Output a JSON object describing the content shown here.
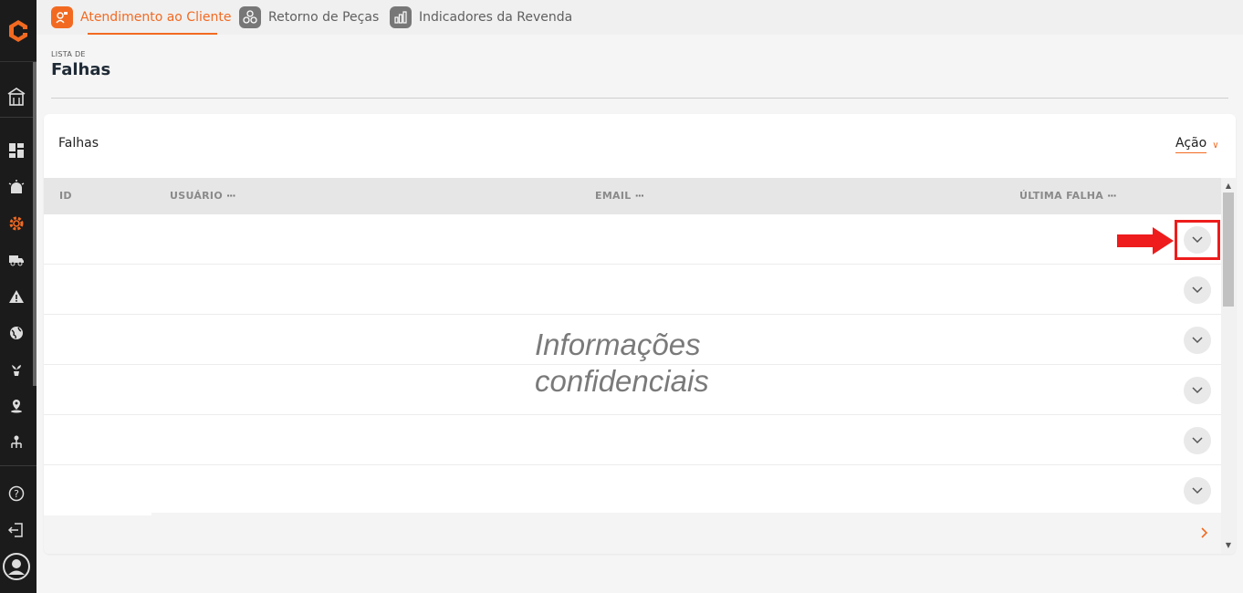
{
  "topbar": {
    "tabs": [
      {
        "label": "Atendimento ao Cliente",
        "icon": "customer-service-icon",
        "active": true
      },
      {
        "label": "Retorno de Peças",
        "icon": "parts-return-icon",
        "active": false
      },
      {
        "label": "Indicadores da Revenda",
        "icon": "bar-chart-icon",
        "active": false
      }
    ]
  },
  "sidebar": {
    "items": [
      "company-icon",
      "dashboard-icon",
      "alarm-icon",
      "settings-gear-icon",
      "truck-icon",
      "warning-icon",
      "globe-icon",
      "plant-icon",
      "location-icon",
      "hierarchy-icon",
      "help-icon",
      "logout-icon",
      "user-avatar-icon"
    ]
  },
  "page": {
    "label": "LISTA DE",
    "title": "Falhas"
  },
  "card": {
    "title": "Falhas",
    "action_label": "Ação"
  },
  "table": {
    "columns": [
      {
        "label": "ID",
        "menu": ""
      },
      {
        "label": "USUÁRIO",
        "menu": "···"
      },
      {
        "label": "EMAIL",
        "menu": "···"
      },
      {
        "label": "ÚLTIMA FALHA",
        "menu": "···"
      }
    ],
    "row_count": 6
  },
  "overlay": {
    "line1": "Informações",
    "line2": "confidenciais"
  },
  "colors": {
    "accent": "#f26a21",
    "sidebar_bg": "#1b1b1b",
    "highlight": "#ee1c1c"
  }
}
